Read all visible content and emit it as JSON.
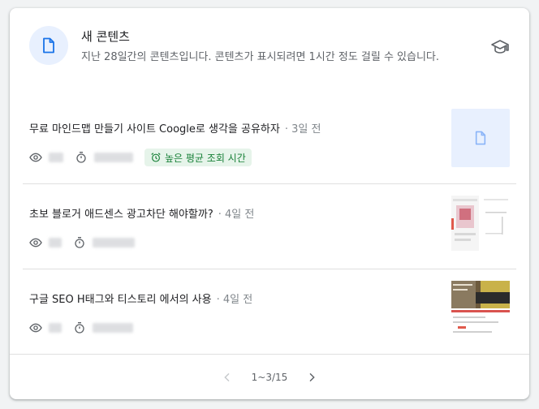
{
  "header": {
    "title": "새 콘텐츠",
    "description": "지난 28일간의 콘텐츠입니다. 콘텐츠가 표시되려면 1시간 정도 걸릴 수 있습니다.",
    "icon": "document-icon",
    "help_icon": "school-icon"
  },
  "items": [
    {
      "title": "무료 마인드맵 만들기 사이트 Coogle로 생각을 공유하자",
      "date": "· 3일 전",
      "badge": "높은 평균 조회 시간",
      "thumbnail": "placeholder"
    },
    {
      "title": "초보 블로거 애드센스 광고차단 해야할까?",
      "date": "· 4일 전",
      "thumbnail": "image"
    },
    {
      "title": "구글 SEO H태그와 티스토리 에서의 사용",
      "date": "· 4일 전",
      "thumbnail": "image"
    }
  ],
  "pagination": {
    "label": "1~3/15"
  },
  "colors": {
    "accent": "#1a73e8",
    "badge_bg": "#e6f4ea",
    "badge_text": "#188038",
    "divider": "#e0e0e0"
  }
}
